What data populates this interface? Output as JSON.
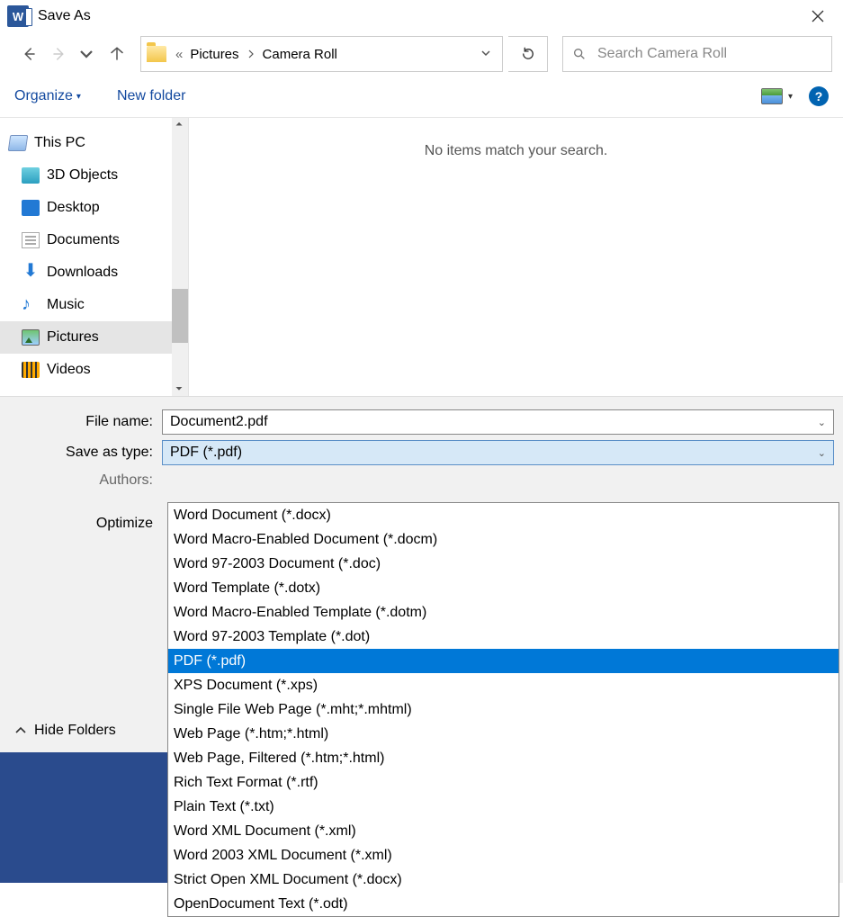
{
  "title": "Save As",
  "breadcrumb": {
    "prefix": "«",
    "part1": "Pictures",
    "part2": "Camera Roll"
  },
  "search": {
    "placeholder": "Search Camera Roll"
  },
  "toolbar": {
    "organize": "Organize",
    "newfolder": "New folder"
  },
  "tree": {
    "root": "This PC",
    "items": [
      {
        "label": "3D Objects"
      },
      {
        "label": "Desktop"
      },
      {
        "label": "Documents"
      },
      {
        "label": "Downloads"
      },
      {
        "label": "Music"
      },
      {
        "label": "Pictures"
      },
      {
        "label": "Videos"
      }
    ]
  },
  "content": {
    "empty": "No items match your search."
  },
  "form": {
    "filename_label": "File name:",
    "filename_value": "Document2.pdf",
    "type_label": "Save as type:",
    "type_value": "PDF (*.pdf)",
    "authors_label": "Authors:",
    "optimize_label": "Optimize"
  },
  "hide_folders": "Hide Folders",
  "type_options": [
    "Word Document (*.docx)",
    "Word Macro-Enabled Document (*.docm)",
    "Word 97-2003 Document (*.doc)",
    "Word Template (*.dotx)",
    "Word Macro-Enabled Template (*.dotm)",
    "Word 97-2003 Template (*.dot)",
    "PDF (*.pdf)",
    "XPS Document (*.xps)",
    "Single File Web Page (*.mht;*.mhtml)",
    "Web Page (*.htm;*.html)",
    "Web Page, Filtered (*.htm;*.html)",
    "Rich Text Format (*.rtf)",
    "Plain Text (*.txt)",
    "Word XML Document (*.xml)",
    "Word 2003 XML Document (*.xml)",
    "Strict Open XML Document (*.docx)",
    "OpenDocument Text (*.odt)"
  ],
  "type_selected_index": 6
}
